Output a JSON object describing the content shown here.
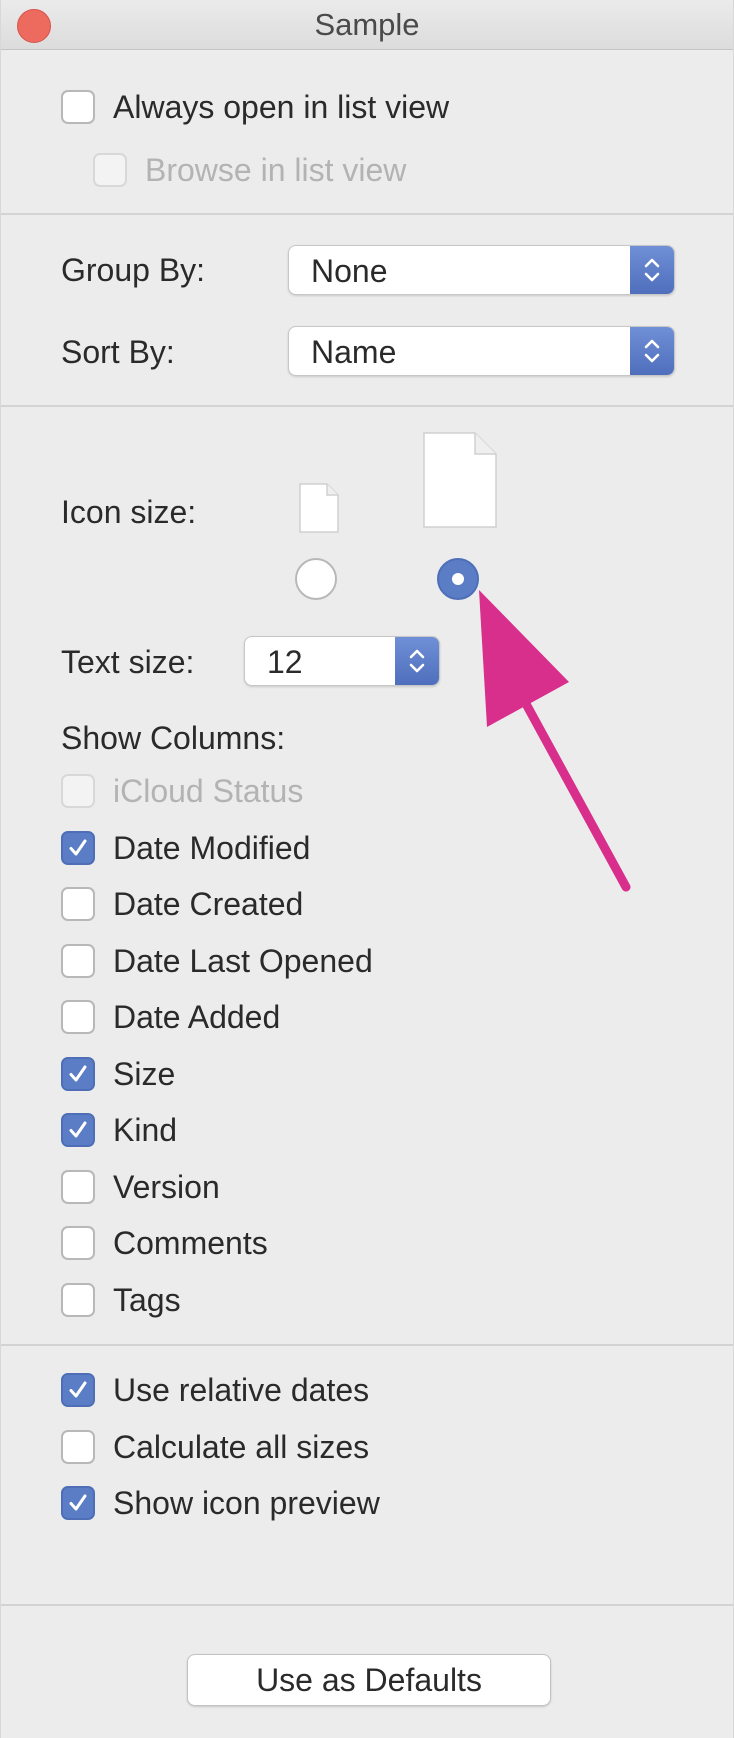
{
  "window": {
    "title": "Sample"
  },
  "view_options": {
    "always_open_list": {
      "label": "Always open in list view",
      "checked": false
    },
    "browse_list": {
      "label": "Browse in list view",
      "checked": false,
      "disabled": true
    }
  },
  "grouping": {
    "group_by_label": "Group By:",
    "group_by_value": "None",
    "sort_by_label": "Sort By:",
    "sort_by_value": "Name"
  },
  "icon_size": {
    "label": "Icon size:",
    "options": [
      "small",
      "large"
    ],
    "selected": "large"
  },
  "text_size": {
    "label": "Text size:",
    "value": "12"
  },
  "columns": {
    "header": "Show Columns:",
    "items": [
      {
        "label": "iCloud Status",
        "checked": false,
        "disabled": true
      },
      {
        "label": "Date Modified",
        "checked": true
      },
      {
        "label": "Date Created",
        "checked": false
      },
      {
        "label": "Date Last Opened",
        "checked": false
      },
      {
        "label": "Date Added",
        "checked": false
      },
      {
        "label": "Size",
        "checked": true
      },
      {
        "label": "Kind",
        "checked": true
      },
      {
        "label": "Version",
        "checked": false
      },
      {
        "label": "Comments",
        "checked": false
      },
      {
        "label": "Tags",
        "checked": false
      }
    ]
  },
  "options": {
    "items": [
      {
        "label": "Use relative dates",
        "checked": true
      },
      {
        "label": "Calculate all sizes",
        "checked": false
      },
      {
        "label": "Show icon preview",
        "checked": true
      }
    ]
  },
  "footer": {
    "defaults_label": "Use as Defaults"
  },
  "colors": {
    "accent": "#5b7dc6",
    "close_button": "#ed6a5e",
    "annotation_arrow": "#d82e8c"
  },
  "icons": {
    "checkmark": "checkmark-icon",
    "stepper": "chevron-updown-icon",
    "document": "document-icon"
  }
}
